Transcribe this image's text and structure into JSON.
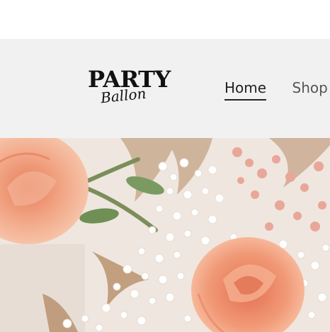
{
  "brand": {
    "logo_top": "PARTY",
    "logo_bottom": "Ballon"
  },
  "nav": {
    "items": [
      {
        "label": "Home",
        "active": true
      },
      {
        "label": "Shop L",
        "active": false
      }
    ]
  },
  "hero": {
    "alt": "Dried flower bouquet with peach roses, baby's breath and pampas grass"
  },
  "colors": {
    "header_bg": "#f1f1f1",
    "rose": "#f0a27f",
    "leaf": "#6f8f55"
  }
}
